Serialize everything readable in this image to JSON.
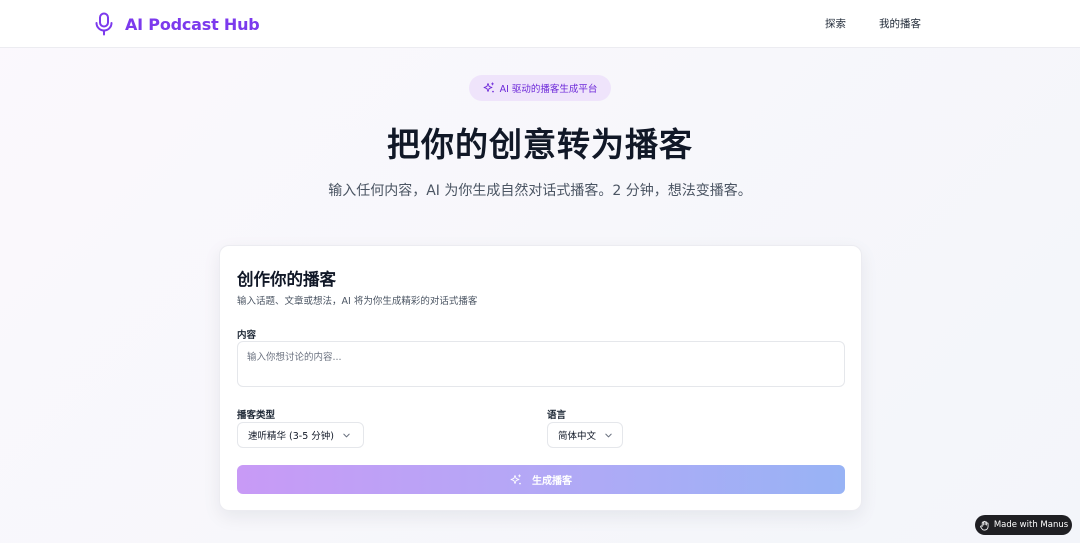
{
  "header": {
    "brand_name": "AI Podcast Hub",
    "nav": {
      "explore": "探索",
      "my_podcasts": "我的播客"
    }
  },
  "hero": {
    "badge": "AI 驱动的播客生成平台",
    "title": "把你的创意转为播客",
    "subtitle": "输入任何内容，AI 为你生成自然对话式播客。2 分钟，想法变播客。"
  },
  "form": {
    "title": "创作你的播客",
    "description": "输入话题、文章或想法，AI 将为你生成精彩的对话式播客",
    "content_label": "内容",
    "content_placeholder": "输入你想讨论的内容...",
    "content_value": "",
    "type_label": "播客类型",
    "type_value": "速听精华 (3-5 分钟)",
    "language_label": "语言",
    "language_value": "简体中文",
    "generate_label": "生成播客"
  },
  "footer_badge": {
    "label": "Made with Manus"
  },
  "colors": {
    "brand": "#7c3aed",
    "badge_bg": "#efe4fb",
    "button_gradient_start": "#c89af6",
    "button_gradient_end": "#98b3f5"
  },
  "icons": {
    "brand": "microphone-icon",
    "badge": "sparkles-icon",
    "select": "chevron-down-icon",
    "generate": "sparkles-icon",
    "manus": "hand-icon"
  }
}
